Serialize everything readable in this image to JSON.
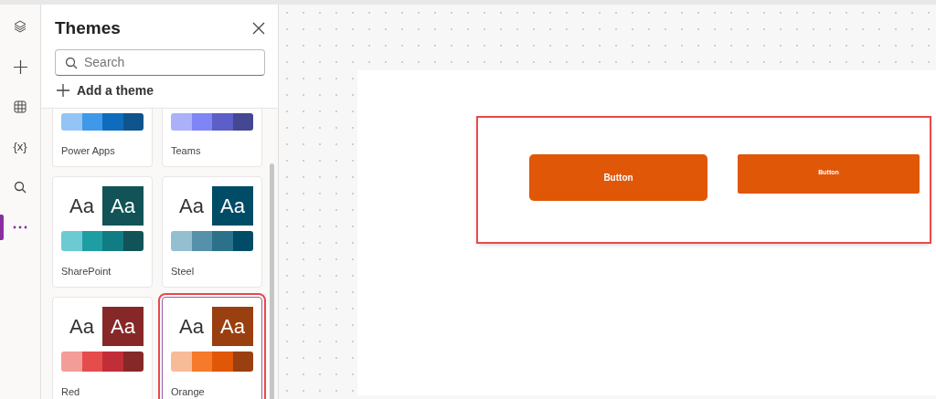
{
  "rail": [
    {
      "kind": "layers",
      "selected": false
    },
    {
      "kind": "plus",
      "selected": false
    },
    {
      "kind": "table",
      "selected": false
    },
    {
      "kind": "text",
      "label": "{x}",
      "selected": false
    },
    {
      "kind": "search",
      "selected": false
    },
    {
      "kind": "more",
      "selected": true
    }
  ],
  "panel": {
    "title": "Themes",
    "search": {
      "placeholder": "Search"
    },
    "add_label": "Add a theme",
    "themes": [
      {
        "name": "Power Apps",
        "selected": false,
        "highlighted": false,
        "palette": [
          {
            "color": "#94c4f5"
          },
          {
            "color": "#3f99e8"
          },
          {
            "color": "#0f6cbd"
          },
          {
            "color": "#0f548c"
          }
        ]
      },
      {
        "name": "Teams",
        "selected": false,
        "highlighted": false,
        "palette": [
          {
            "color": "#aab1fa"
          },
          {
            "color": "#7f85f5"
          },
          {
            "color": "#5b5fc7"
          },
          {
            "color": "#444791"
          }
        ]
      },
      {
        "name": "SharePoint",
        "selected": false,
        "highlighted": false,
        "preview": [
          {
            "text": "Aa",
            "color": "#ffffff"
          },
          {
            "text": "Aa",
            "color": "#115357"
          }
        ],
        "palette": [
          {
            "color": "#6ccbd2"
          },
          {
            "color": "#1e9ea3"
          },
          {
            "color": "#0f7d83"
          },
          {
            "color": "#115357"
          }
        ]
      },
      {
        "name": "Steel",
        "selected": false,
        "highlighted": false,
        "preview": [
          {
            "text": "Aa",
            "color": "#ffffff"
          },
          {
            "text": "Aa",
            "color": "#004c66"
          }
        ],
        "palette": [
          {
            "color": "#94bfd0"
          },
          {
            "color": "#5591a8"
          },
          {
            "color": "#2b7189"
          },
          {
            "color": "#004c66"
          }
        ]
      },
      {
        "name": "Red",
        "selected": false,
        "highlighted": false,
        "preview": [
          {
            "text": "Aa",
            "color": "#ffffff"
          },
          {
            "text": "Aa",
            "color": "#872828"
          }
        ],
        "palette": [
          {
            "color": "#f49c97"
          },
          {
            "color": "#e54d4d"
          },
          {
            "color": "#c22e37"
          },
          {
            "color": "#872828"
          }
        ]
      },
      {
        "name": "Orange",
        "selected": true,
        "highlighted": true,
        "preview": [
          {
            "text": "Aa",
            "color": "#ffffff"
          },
          {
            "text": "Aa",
            "color": "#9a4010"
          }
        ],
        "palette": [
          {
            "color": "#f8bb97"
          },
          {
            "color": "#f57a2a"
          },
          {
            "color": "#e05707"
          },
          {
            "color": "#9a4010"
          }
        ]
      }
    ]
  },
  "canvas": {
    "highlighted": true,
    "buttons": [
      {
        "label": "Button",
        "kind": "rounded"
      },
      {
        "label": "Button",
        "kind": "small"
      }
    ]
  }
}
